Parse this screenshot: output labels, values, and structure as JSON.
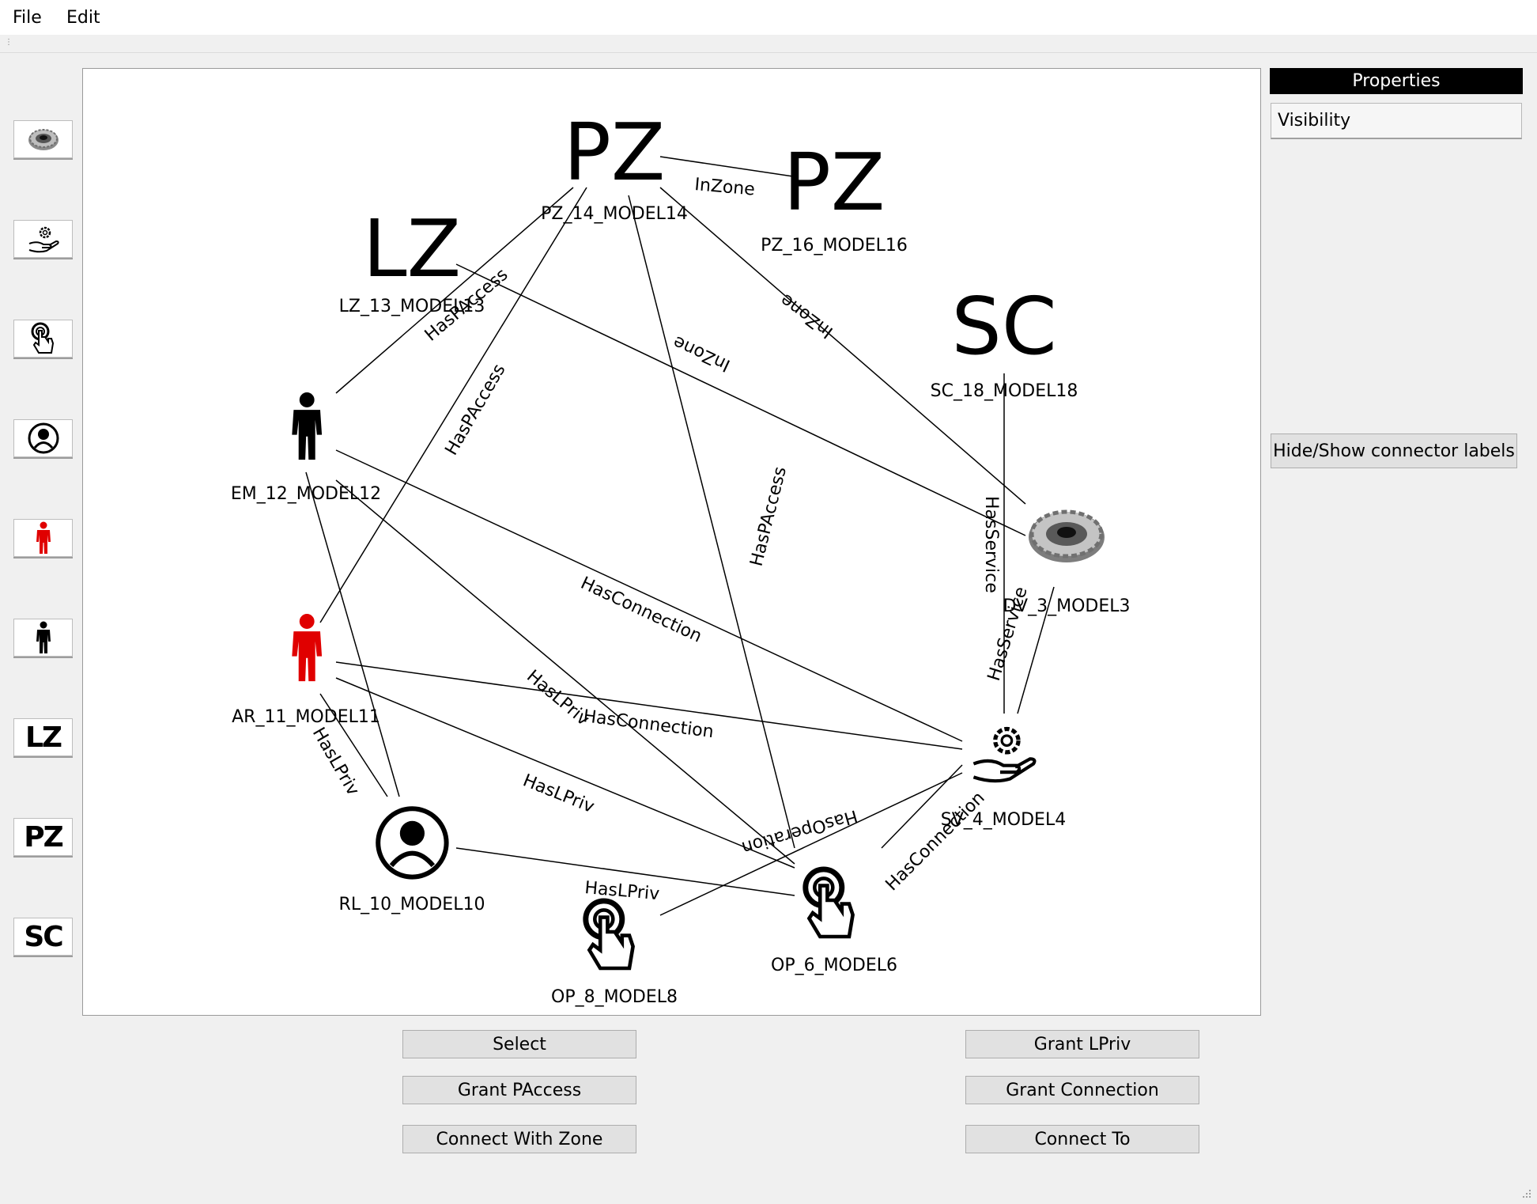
{
  "menu": {
    "file": "File",
    "edit": "Edit"
  },
  "palette": {
    "items": [
      {
        "name": "device",
        "icon": "gear-disc-icon"
      },
      {
        "name": "service",
        "icon": "hand-gear-icon"
      },
      {
        "name": "operation",
        "icon": "touch-hand-icon"
      },
      {
        "name": "role",
        "icon": "user-circle-icon"
      },
      {
        "name": "admin-role",
        "icon": "red-person-icon"
      },
      {
        "name": "employee",
        "icon": "black-person-icon"
      },
      {
        "name": "logical-zone",
        "text": "LZ"
      },
      {
        "name": "physical-zone",
        "text": "PZ"
      },
      {
        "name": "security-class",
        "text": "SC"
      }
    ]
  },
  "diagram": {
    "nodes": [
      {
        "id": "pz14",
        "glyph": "PZ",
        "label": "PZ_14_MODEL14"
      },
      {
        "id": "pz16",
        "glyph": "PZ",
        "label": "PZ_16_MODEL16"
      },
      {
        "id": "lz13",
        "glyph": "LZ",
        "label": "LZ_13_MODEL13"
      },
      {
        "id": "sc18",
        "glyph": "SC",
        "label": "SC_18_MODEL18"
      },
      {
        "id": "em12",
        "icon": "black-person-icon",
        "label": "EM_12_MODEL12"
      },
      {
        "id": "dv3",
        "icon": "gear-disc-icon",
        "label": "DV_3_MODEL3"
      },
      {
        "id": "ar11",
        "icon": "red-person-icon",
        "label": "AR_11_MODEL11"
      },
      {
        "id": "sv4",
        "icon": "hand-gear-icon",
        "label": "SV_4_MODEL4"
      },
      {
        "id": "rl10",
        "icon": "user-circle-icon",
        "label": "RL_10_MODEL10"
      },
      {
        "id": "op6",
        "icon": "touch-hand-icon",
        "label": "OP_6_MODEL6"
      },
      {
        "id": "op8",
        "icon": "touch-hand-icon",
        "label": "OP_8_MODEL8"
      }
    ],
    "edge_labels": {
      "pz14_pz16": "InZone",
      "pz14_dv3": "InZone",
      "lz13_dv3": "InZone",
      "em12_lz13": "HasPAccess",
      "ar11_pz14": "HasPAccess",
      "op6_pz14": "HasPAccess",
      "sc18_sv4": "HasService",
      "dv3_sv4": "HasService",
      "em12_sv4": "HasConnection",
      "ar11_sv4": "HasConnection",
      "sv4_op6": "HasConnection",
      "em12_op6": "HasLPriv",
      "ar11_op6": "HasLPriv",
      "ar11_rl10": "HasLPriv",
      "sv4_op8": "HasOperation",
      "rl10_op6": "HasLPriv",
      "ar11_hidden": "HasLPriv"
    }
  },
  "buttons": {
    "select": "Select",
    "grant_paccess": "Grant PAccess",
    "connect_with_zone": "Connect With Zone",
    "grant_lpriv": "Grant LPriv",
    "grant_connection": "Grant Connection",
    "connect_to": "Connect To"
  },
  "properties": {
    "header": "Properties",
    "visibility": "Visibility",
    "hide_show": "Hide/Show connector labels"
  }
}
